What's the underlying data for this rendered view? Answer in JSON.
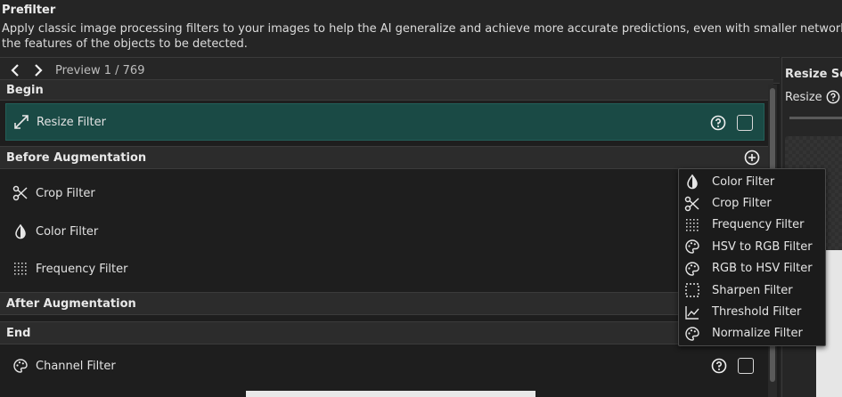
{
  "header": {
    "title": "Prefilter",
    "description_line1": "Apply classic image processing filters to your images to help the AI generalize and achieve more accurate predictions, even with smaller networks. The goal is to elimi",
    "description_line2": "the features of the objects to be detected."
  },
  "preview": {
    "label": "Preview 1 / 769",
    "prev_icon": "chevron-left-icon",
    "next_icon": "chevron-right-icon"
  },
  "sections": {
    "begin": "Begin",
    "before_augmentation": "Before Augmentation",
    "after_augmentation": "After Augmentation",
    "end": "End"
  },
  "filters": {
    "resize": {
      "label": "Resize Filter",
      "icon": "resize-arrows-icon",
      "selected": true
    },
    "crop": {
      "label": "Crop Filter",
      "icon": "scissors-icon"
    },
    "color": {
      "label": "Color Filter",
      "icon": "contrast-drop-icon"
    },
    "frequency": {
      "label": "Frequency Filter",
      "icon": "dot-grid-icon"
    },
    "channel": {
      "label": "Channel Filter",
      "icon": "palette-icon"
    }
  },
  "dropdown": {
    "items": [
      {
        "label": "Color Filter",
        "icon": "contrast-drop-icon"
      },
      {
        "label": "Crop Filter",
        "icon": "scissors-icon"
      },
      {
        "label": "Frequency Filter",
        "icon": "dot-grid-icon"
      },
      {
        "label": "HSV to RGB Filter",
        "icon": "palette-icon"
      },
      {
        "label": "RGB to HSV Filter",
        "icon": "palette-icon"
      },
      {
        "label": "Sharpen Filter",
        "icon": "dashed-square-icon"
      },
      {
        "label": "Threshold Filter",
        "icon": "line-chart-icon"
      },
      {
        "label": "Normalize Filter",
        "icon": "palette-icon"
      }
    ]
  },
  "right_panel": {
    "title": "Resize Setti",
    "resize_label": "Resize"
  },
  "colors": {
    "selected_row": "#1a4a45",
    "background": "#1e1e1e",
    "section": "#2c2c2c"
  }
}
